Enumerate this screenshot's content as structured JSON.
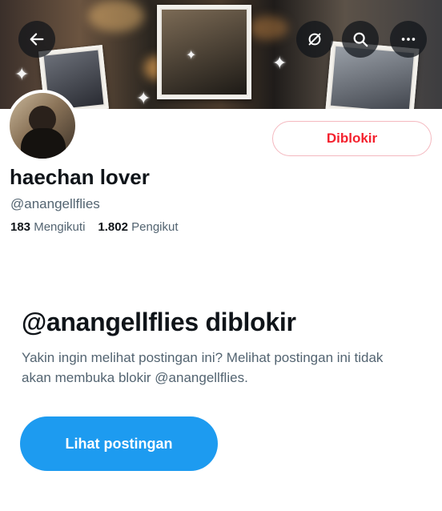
{
  "profile": {
    "display_name": "haechan lover",
    "handle": "@anangellflies",
    "following_count": "183",
    "following_label": "Mengikuti",
    "followers_count": "1.802",
    "followers_label": "Pengikut"
  },
  "header": {
    "back_icon": "arrow-left-icon",
    "icons": [
      "arrow-left-icon",
      "refresh-slash-icon",
      "search-icon",
      "more-horizontal-icon"
    ]
  },
  "actions": {
    "blocked_label": "Diblokir",
    "view_posts_label": "Lihat postingan"
  },
  "blocked_notice": {
    "title": "@anangellflies diblokir",
    "description": "Yakin ingin melihat postingan ini? Melihat postingan ini tidak akan membuka blokir @anangellflies."
  },
  "colors": {
    "accent": "#1d9bf0",
    "danger": "#f4212e",
    "text_primary": "#0f1419",
    "text_secondary": "#536471"
  }
}
